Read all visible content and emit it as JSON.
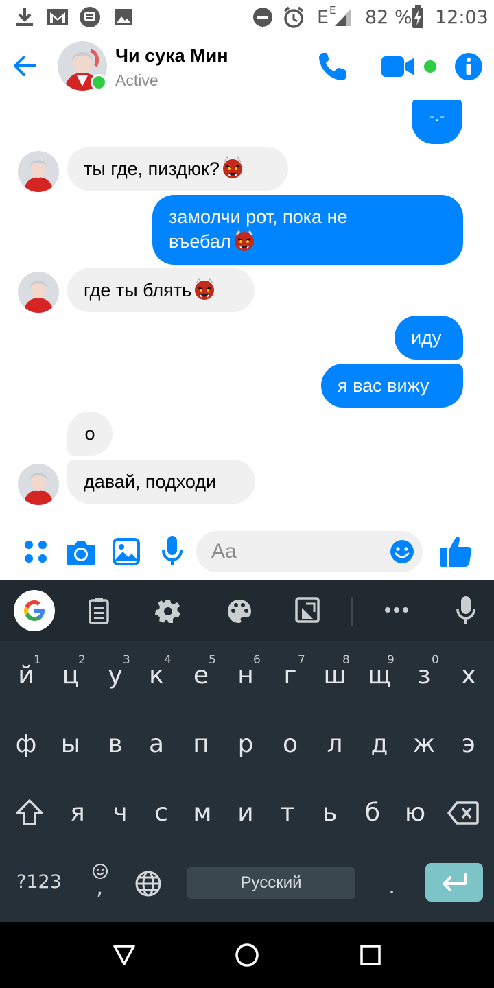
{
  "status_bar": {
    "network": "E",
    "network_small": "E",
    "battery": "82 %",
    "time": "12:03"
  },
  "header": {
    "contact_name": "Чи сука Мин",
    "status": "Active"
  },
  "messages": [
    {
      "side": "out",
      "text": "-.-"
    },
    {
      "side": "in",
      "text": "ты где, пиздюк?",
      "emoji": "ogre-face"
    },
    {
      "side": "out",
      "line1": "замолчи рот, пока не",
      "line2": "въебал",
      "emoji": "ogre-face"
    },
    {
      "side": "in",
      "text": "где ты блять",
      "emoji": "ogre-face"
    },
    {
      "side": "out",
      "text": "иду"
    },
    {
      "side": "out",
      "text": "я вас вижу"
    },
    {
      "side": "in",
      "text": "о"
    },
    {
      "side": "in",
      "text": "давай, подходи"
    }
  ],
  "composer": {
    "placeholder": "Aa"
  },
  "keyboard": {
    "row1": [
      "й",
      "ц",
      "у",
      "к",
      "е",
      "н",
      "г",
      "ш",
      "щ",
      "з",
      "х"
    ],
    "row1_hints": [
      "1",
      "2",
      "3",
      "4",
      "5",
      "6",
      "7",
      "8",
      "9",
      "0"
    ],
    "row2": [
      "ф",
      "ы",
      "в",
      "а",
      "п",
      "р",
      "о",
      "л",
      "д",
      "ж",
      "э"
    ],
    "row3": [
      "я",
      "ч",
      "с",
      "м",
      "и",
      "т",
      "ь",
      "б",
      "ю"
    ],
    "symbols_key": "?123",
    "comma_key": ",",
    "space_label": "Русский",
    "period_key": "."
  },
  "colors": {
    "accent": "#0084ff",
    "active_green": "#31cc46",
    "keyboard_bg": "#263038",
    "enter_key": "#7cc4c7"
  }
}
